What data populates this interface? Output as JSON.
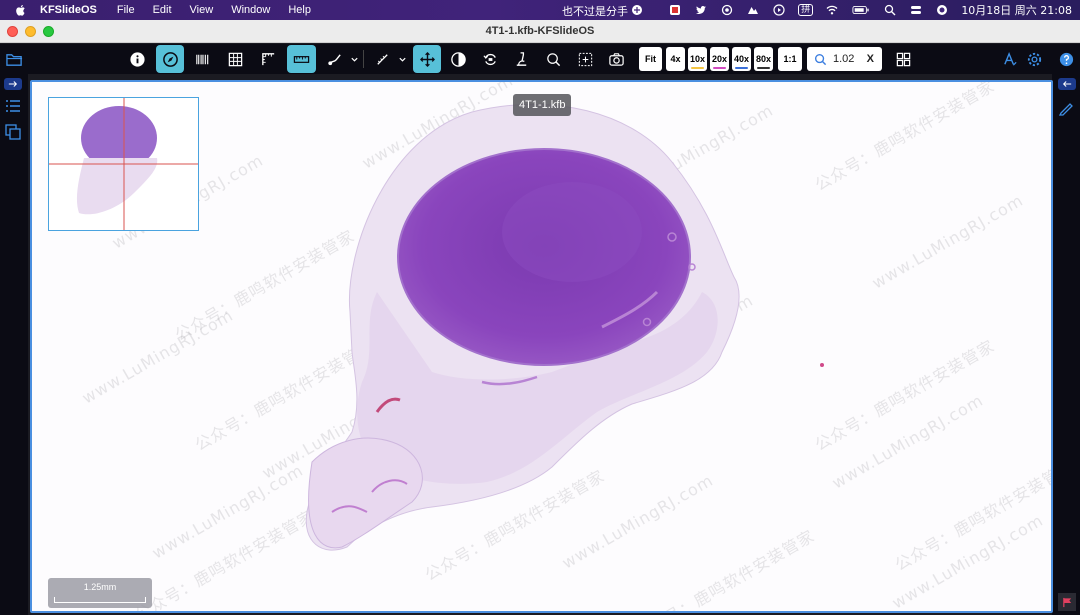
{
  "menubar": {
    "app_name": "KFSlideOS",
    "menus": [
      "File",
      "Edit",
      "View",
      "Window",
      "Help"
    ],
    "status_text": "也不过是分手",
    "ime_label": "拼",
    "clock": "10月18日 周六 21:08"
  },
  "window": {
    "title": "4T1-1.kfb-KFSlideOS"
  },
  "toolbar": {
    "zoom_buttons": [
      {
        "label": "Fit",
        "color": ""
      },
      {
        "label": "4x",
        "color": ""
      },
      {
        "label": "10x",
        "color": "#f4c542"
      },
      {
        "label": "20x",
        "color": "#d24bc0"
      },
      {
        "label": "40x",
        "color": "#3a6fd8"
      },
      {
        "label": "80x",
        "color": "#333333"
      },
      {
        "label": "1:1",
        "color": ""
      }
    ],
    "zoom_value": "1.02",
    "zoom_clear": "X",
    "accent": "#57c0d8"
  },
  "viewer": {
    "file_label": "4T1-1.kfb",
    "scale_label": "1.25mm",
    "watermarks": [
      "www.LuMingRJ.com",
      "公众号：鹿鸣软件安装管家"
    ]
  }
}
